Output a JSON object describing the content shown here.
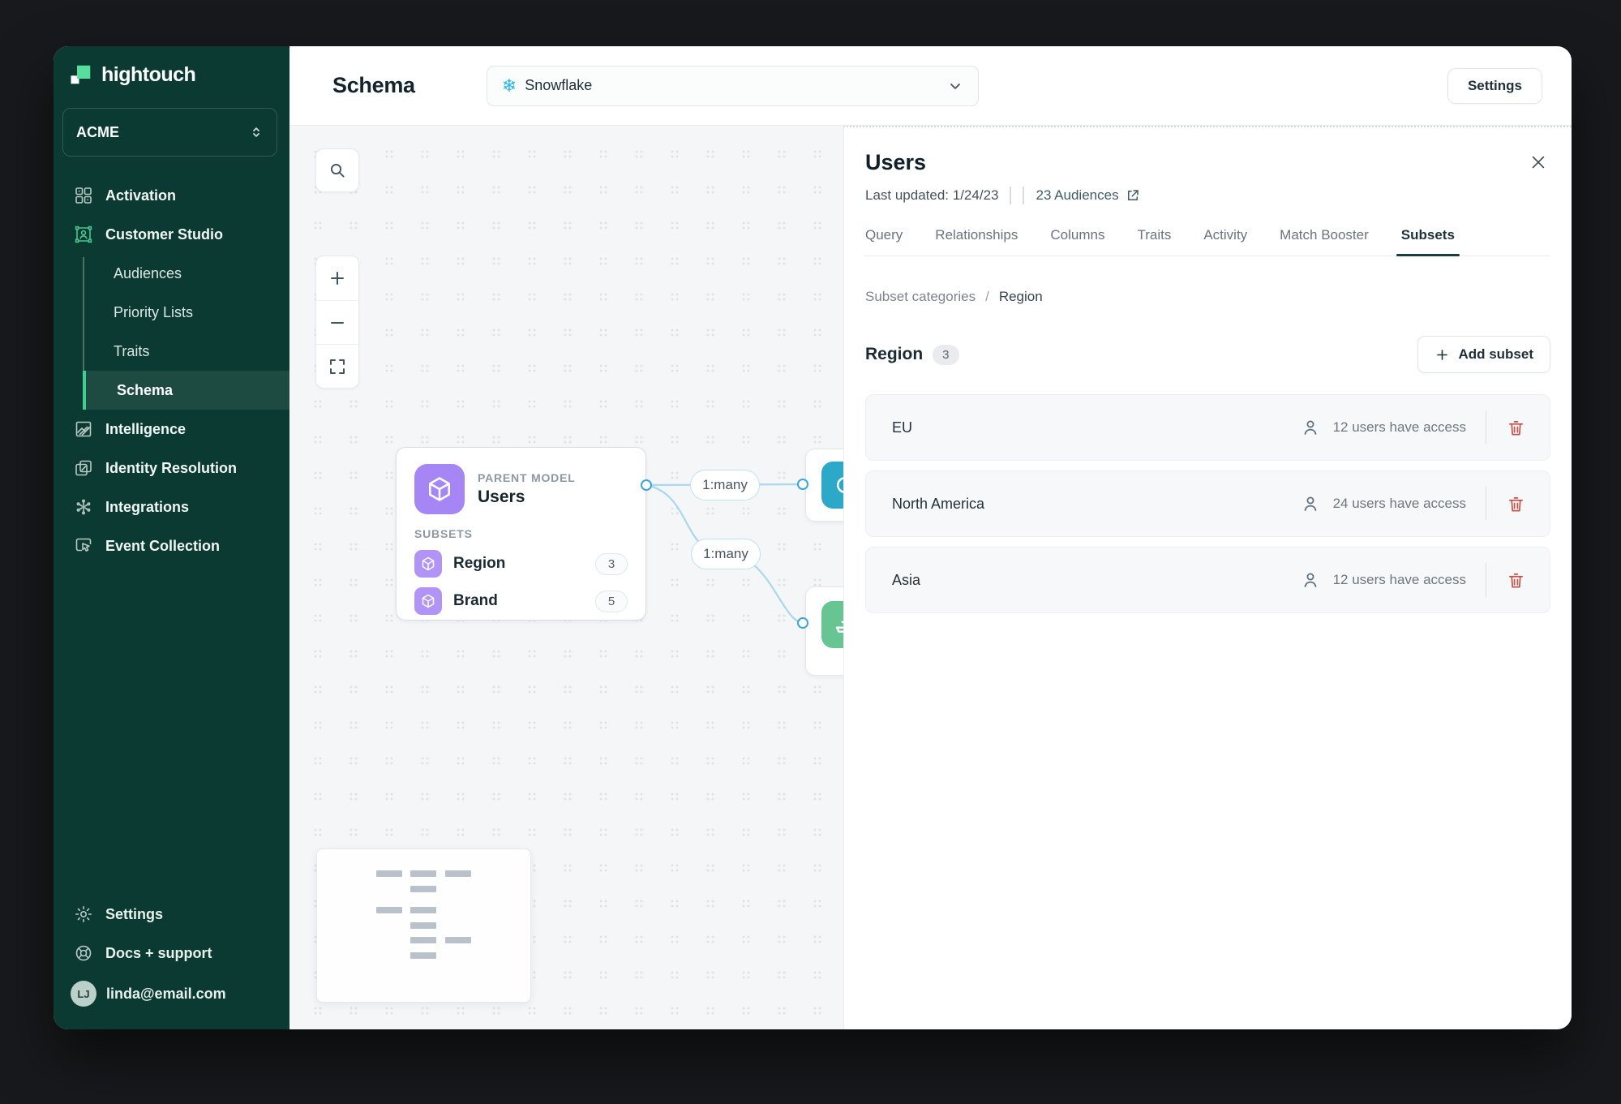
{
  "colors": {
    "sidebar_bg": "#0B3A33",
    "brand_green": "#3ED08E",
    "purple": "#A685F5",
    "teal_node": "#2CA8C9",
    "green_node": "#66C593",
    "danger_red": "#C0544A",
    "snowflake_blue": "#29B5E8",
    "edge_blue": "#A9D7EC"
  },
  "sidebar": {
    "logo": "hightouch",
    "workspace": "ACME",
    "nav": {
      "activation": "Activation",
      "customer_studio": "Customer Studio",
      "audiences": "Audiences",
      "priority_lists": "Priority Lists",
      "traits": "Traits",
      "schema": "Schema",
      "intelligence": "Intelligence",
      "identity_resolution": "Identity Resolution",
      "integrations": "Integrations",
      "event_collection": "Event Collection"
    },
    "footer": {
      "settings": "Settings",
      "docs": "Docs + support",
      "avatar_initials": "LJ",
      "email": "linda@email.com"
    }
  },
  "topbar": {
    "title": "Schema",
    "source": "Snowflake",
    "settings": "Settings"
  },
  "canvas": {
    "parent_model": {
      "kicker": "PARENT MODEL",
      "name": "Users",
      "subsets_heading": "SUBSETS",
      "subset_rows": [
        {
          "name": "Region",
          "count": "3"
        },
        {
          "name": "Brand",
          "count": "5"
        }
      ]
    },
    "edge_labels": {
      "top": "1:many",
      "bottom": "1:many"
    }
  },
  "panel": {
    "title": "Users",
    "meta": {
      "last_updated": "Last updated: 1/24/23",
      "audiences": "23 Audiences"
    },
    "tabs": [
      "Query",
      "Relationships",
      "Columns",
      "Traits",
      "Activity",
      "Match Booster",
      "Subsets"
    ],
    "active_tab": "Subsets",
    "breadcrumb": {
      "root": "Subset categories",
      "separator": "/",
      "current": "Region"
    },
    "section": {
      "title": "Region",
      "count": "3",
      "add_button": "Add subset"
    },
    "subsets": [
      {
        "name": "EU",
        "access": "12 users have access"
      },
      {
        "name": "North America",
        "access": "24 users have access"
      },
      {
        "name": "Asia",
        "access": "12 users have access"
      }
    ]
  }
}
